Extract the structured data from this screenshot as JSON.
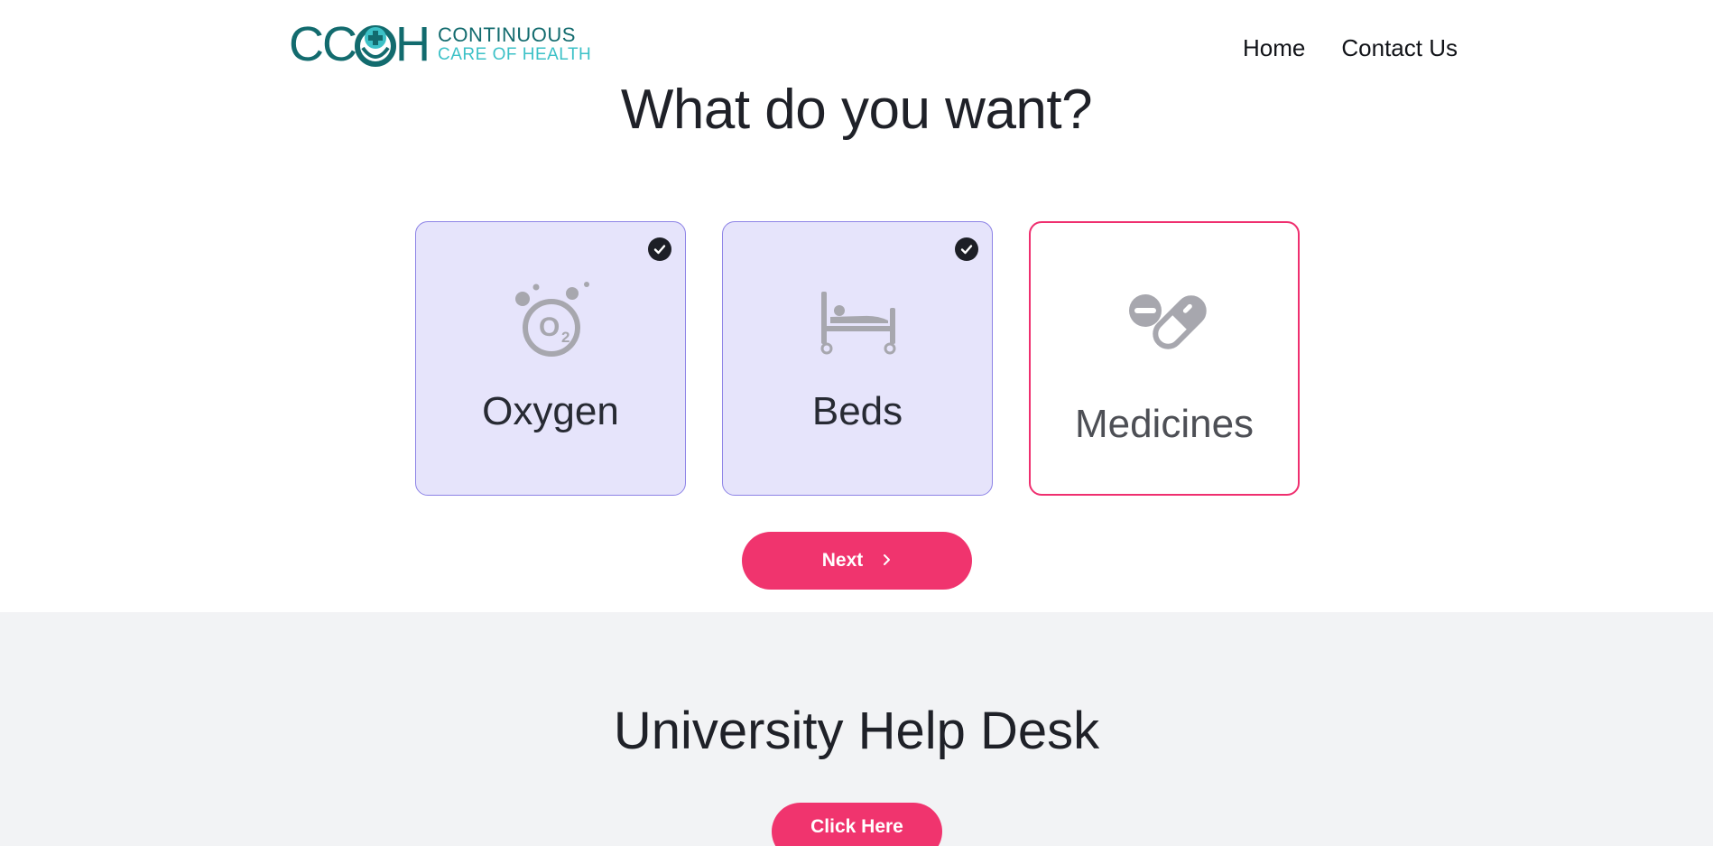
{
  "header": {
    "logo": {
      "mark": "CCOH",
      "line1": "CONTINUOUS",
      "line2": "CARE OF HEALTH"
    },
    "nav": [
      {
        "label": "Home"
      },
      {
        "label": "Contact Us"
      }
    ]
  },
  "main": {
    "title": "What do you want?",
    "cards": [
      {
        "label": "Oxygen",
        "icon": "oxygen-icon",
        "selected": true
      },
      {
        "label": "Beds",
        "icon": "bed-icon",
        "selected": true
      },
      {
        "label": "Medicines",
        "icon": "pills-icon",
        "selected": false
      }
    ],
    "next_label": "Next"
  },
  "help_desk": {
    "title": "University Help Desk",
    "button_label": "Click Here"
  },
  "colors": {
    "accent": "#f0346e",
    "selected_bg": "#e6e4fb",
    "selected_border": "#8d83e6",
    "brand_dark": "#126b6e",
    "brand_light": "#3cc1c7",
    "icon_gray": "#a7a7ae"
  }
}
